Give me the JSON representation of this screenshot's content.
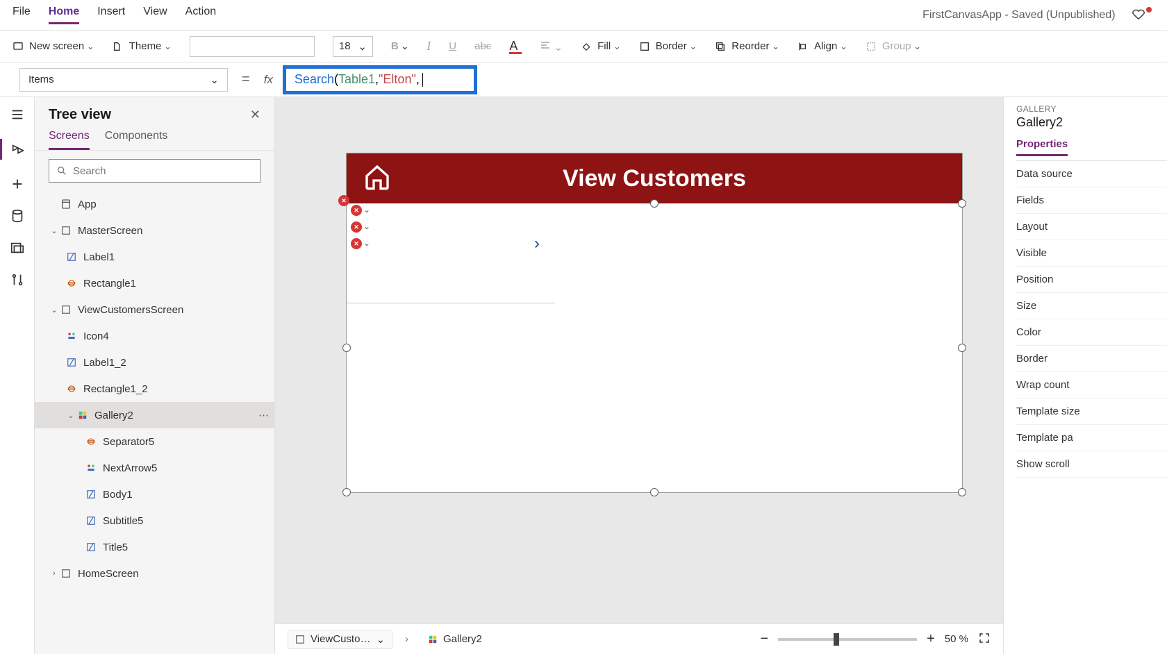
{
  "app_title": "FirstCanvasApp - Saved (Unpublished)",
  "menu": {
    "file": "File",
    "home": "Home",
    "insert": "Insert",
    "view": "View",
    "action": "Action"
  },
  "ribbon": {
    "new_screen": "New screen",
    "theme": "Theme",
    "font_size": "18",
    "bold": "B",
    "italic": "I",
    "underline": "U",
    "fill": "Fill",
    "border": "Border",
    "reorder": "Reorder",
    "align": "Align",
    "group": "Group"
  },
  "formula": {
    "property": "Items",
    "equals": "=",
    "fx": "fx",
    "fn": "Search",
    "open": "(",
    "table": "Table1",
    "sep": ", ",
    "str": "\"Elton\"",
    "tail": ", "
  },
  "tree": {
    "title": "Tree view",
    "tab_screens": "Screens",
    "tab_components": "Components",
    "search_placeholder": "Search",
    "nodes": {
      "app": "App",
      "master": "MasterScreen",
      "label1": "Label1",
      "rect1": "Rectangle1",
      "viewcust": "ViewCustomersScreen",
      "icon4": "Icon4",
      "label1_2": "Label1_2",
      "rect1_2": "Rectangle1_2",
      "gallery2": "Gallery2",
      "sep5": "Separator5",
      "next5": "NextArrow5",
      "body1": "Body1",
      "subtitle5": "Subtitle5",
      "title5": "Title5",
      "home": "HomeScreen"
    }
  },
  "canvas": {
    "header_title": "View Customers"
  },
  "breadcrumb": {
    "screen": "ViewCusto…",
    "element": "Gallery2"
  },
  "zoom": {
    "value": "50",
    "pct": "%"
  },
  "right": {
    "category": "GALLERY",
    "name": "Gallery2",
    "tab": "Properties",
    "rows": {
      "datasource": "Data source",
      "fields": "Fields",
      "layout": "Layout",
      "visible": "Visible",
      "position": "Position",
      "size": "Size",
      "color": "Color",
      "border": "Border",
      "wrap": "Wrap count",
      "template": "Template size",
      "padding": "Template pa",
      "showscroll": "Show scroll"
    }
  }
}
